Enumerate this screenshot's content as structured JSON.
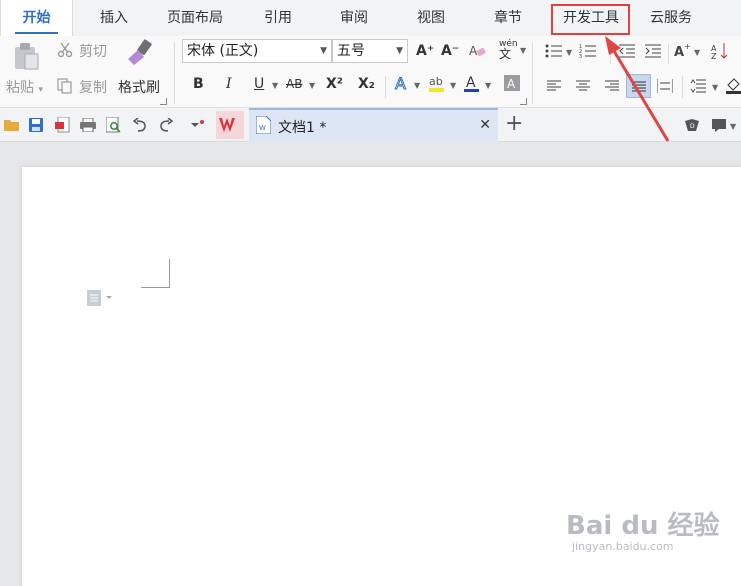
{
  "tabs": [
    {
      "label": "开始"
    },
    {
      "label": "插入"
    },
    {
      "label": "页面布局"
    },
    {
      "label": "引用"
    },
    {
      "label": "审阅"
    },
    {
      "label": "视图"
    },
    {
      "label": "章节"
    },
    {
      "label": "开发工具"
    },
    {
      "label": "云服务"
    }
  ],
  "active_tab": "开始",
  "highlighted_tab": "开发工具",
  "clipboard": {
    "paste_label": "粘贴",
    "cut_label": "剪切",
    "copy_label": "复制",
    "format_painter_label": "格式刷"
  },
  "font": {
    "family_value": "宋体 (正文)",
    "size_value": "五号",
    "bold": "B",
    "italic": "I",
    "underline": "U",
    "strikethrough": "AB",
    "superscript": "X²",
    "subscript": "X₂",
    "grow": "A⁺",
    "shrink": "A⁻",
    "pinyin": "wén"
  },
  "document_tab": {
    "title": "文档1 *"
  },
  "watermark": {
    "brand": "Bai du 经验",
    "url": "jingyan.baidu.com"
  },
  "colors": {
    "accent": "#2f6fc6",
    "highlight_box": "#e04040",
    "arrow": "#e04545",
    "wps_red": "#d9333f"
  }
}
